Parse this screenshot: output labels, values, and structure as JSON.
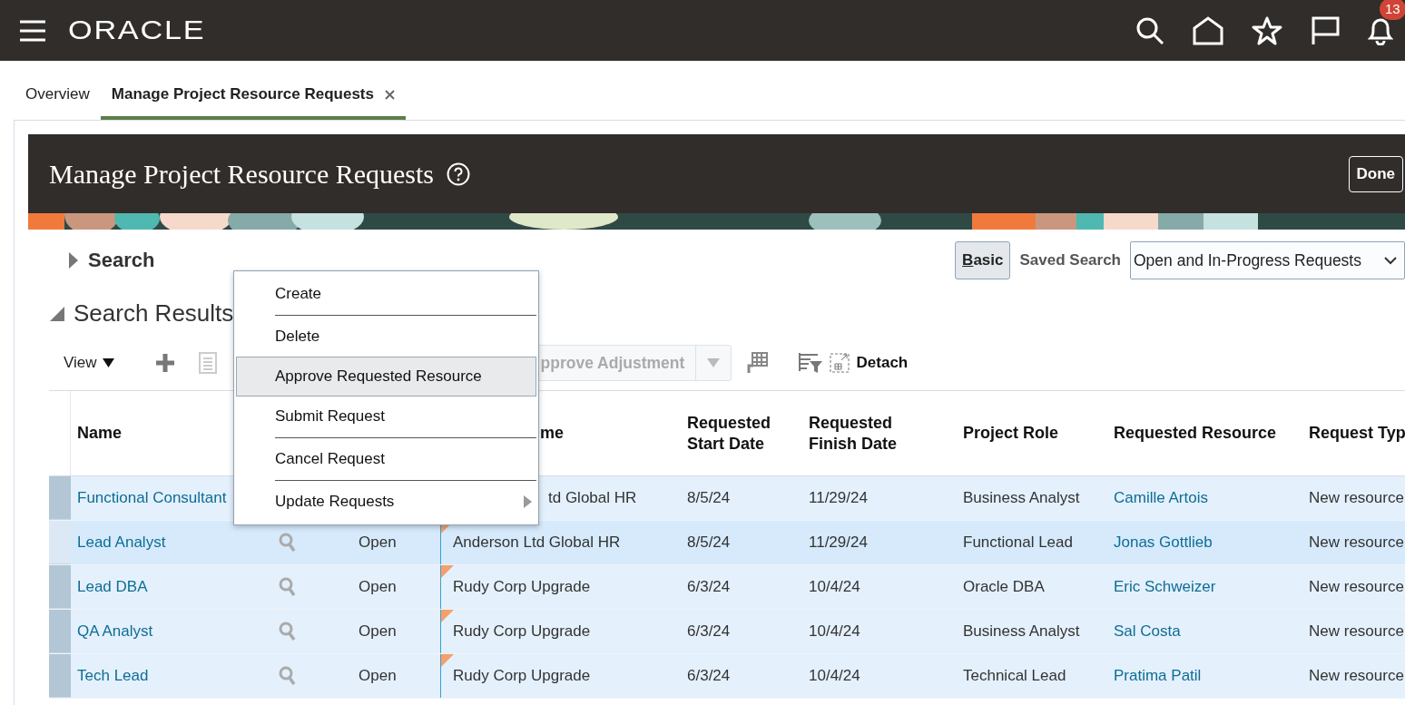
{
  "header": {
    "logo": "ORACLE",
    "notification_count": "13"
  },
  "tabs": [
    {
      "label": "Overview",
      "selected": false,
      "closable": false
    },
    {
      "label": "Manage Project Resource Requests",
      "selected": true,
      "closable": true
    }
  ],
  "page": {
    "title": "Manage Project Resource Requests",
    "done_button": "Done"
  },
  "search": {
    "label": "Search",
    "expanded": false,
    "basic_button": "Basic",
    "saved_search_label": "Saved Search",
    "saved_search_value": "Open and In-Progress Requests"
  },
  "results": {
    "title": "Search Results",
    "expanded": true,
    "toolbar": {
      "view": "View",
      "approve_adjustment": "pprove Adjustment",
      "detach": "Detach"
    }
  },
  "table": {
    "columns": [
      "Name",
      "",
      "",
      "me",
      "Requested Start Date",
      "Requested Finish Date",
      "Project Role",
      "Requested Resource",
      "Request Typ"
    ],
    "rows": [
      {
        "selected": false,
        "name": "Functional Consultant",
        "status": "",
        "project": "td Global HR",
        "start": "8/5/24",
        "finish": "11/29/24",
        "role": "Business Analyst",
        "resource": "Camille Artois",
        "type": "New resource"
      },
      {
        "selected": true,
        "name": "Lead Analyst",
        "status": "Open",
        "project": "Anderson Ltd Global HR",
        "start": "8/5/24",
        "finish": "11/29/24",
        "role": "Functional Lead",
        "resource": "Jonas Gottlieb",
        "type": "New resource"
      },
      {
        "selected": false,
        "name": "Lead DBA",
        "status": "Open",
        "project": "Rudy Corp Upgrade",
        "start": "6/3/24",
        "finish": "10/4/24",
        "role": "Oracle DBA",
        "resource": "Eric Schweizer",
        "type": "New resource"
      },
      {
        "selected": false,
        "name": "QA Analyst",
        "status": "Open",
        "project": "Rudy Corp Upgrade",
        "start": "6/3/24",
        "finish": "10/4/24",
        "role": "Business Analyst",
        "resource": "Sal Costa",
        "type": "New resource"
      },
      {
        "selected": false,
        "name": "Tech Lead",
        "status": "Open",
        "project": "Rudy Corp Upgrade",
        "start": "6/3/24",
        "finish": "10/4/24",
        "role": "Technical Lead",
        "resource": "Pratima Patil",
        "type": "New resource"
      }
    ]
  },
  "context_menu": {
    "items": [
      {
        "label": "Create",
        "selected": false,
        "has_submenu": false
      },
      {
        "label": "Delete",
        "selected": false,
        "has_submenu": false
      },
      {
        "label": "Approve Requested Resource",
        "selected": true,
        "has_submenu": false
      },
      {
        "label": "Submit Request",
        "selected": false,
        "has_submenu": false
      },
      {
        "label": "Cancel Request",
        "selected": false,
        "has_submenu": false
      },
      {
        "label": "Update Requests",
        "selected": false,
        "has_submenu": true
      }
    ]
  }
}
